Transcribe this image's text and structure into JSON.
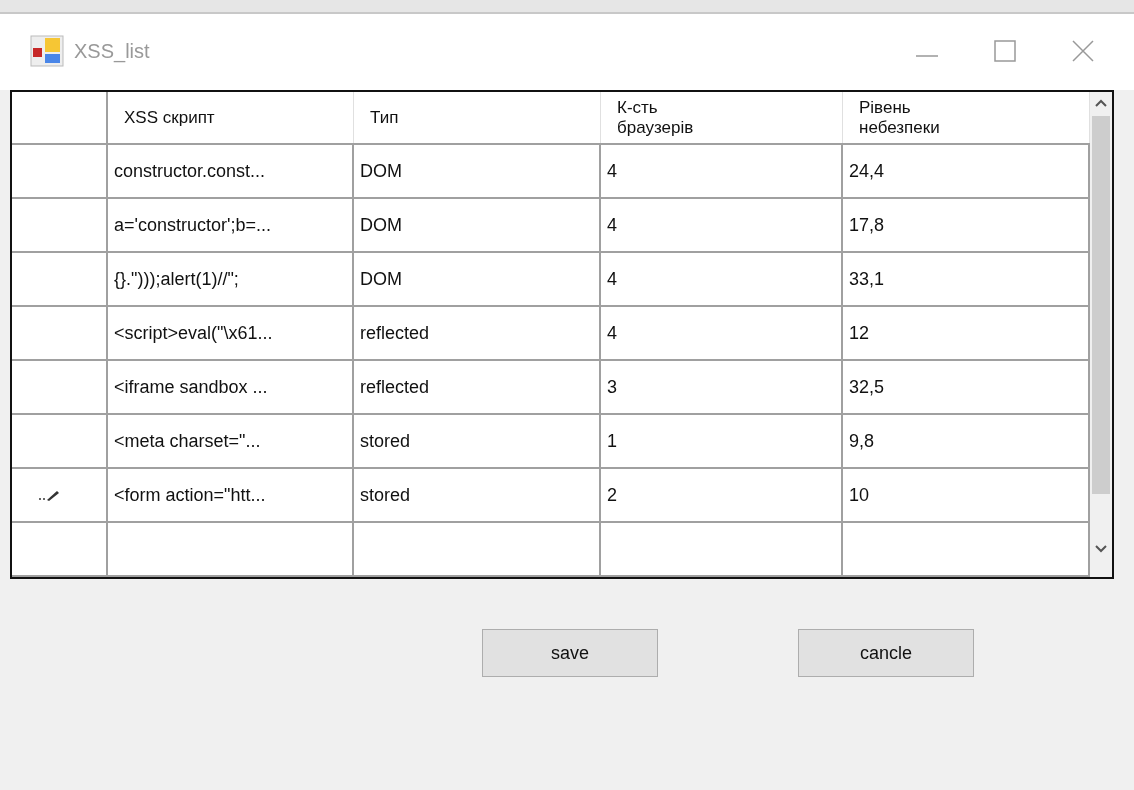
{
  "window": {
    "title": "XSS_list"
  },
  "table": {
    "columns": [
      "XSS скрипт",
      "Тип",
      "К-сть\nбраузерів",
      "Рівень\nнебезпеки"
    ],
    "rows": [
      {
        "cells": [
          "constructor.const...",
          "DOM",
          "4",
          "24,4"
        ],
        "editing": false
      },
      {
        "cells": [
          "a='constructor';b=...",
          "DOM",
          "4",
          "17,8"
        ],
        "editing": false
      },
      {
        "cells": [
          "{}.\")));alert(1)//\";",
          "DOM",
          "4",
          "33,1"
        ],
        "editing": false
      },
      {
        "cells": [
          "<script>eval(\"\\x61...",
          "reflected",
          "4",
          "12"
        ],
        "editing": false
      },
      {
        "cells": [
          "<iframe sandbox ...",
          "reflected",
          "3",
          "32,5"
        ],
        "editing": false
      },
      {
        "cells": [
          "<meta charset=\"...",
          "stored",
          "1",
          "9,8"
        ],
        "editing": false
      },
      {
        "cells": [
          "<form action=\"htt...",
          "stored",
          "2",
          "10"
        ],
        "editing": true
      }
    ]
  },
  "buttons": [
    "save",
    "cancle"
  ]
}
